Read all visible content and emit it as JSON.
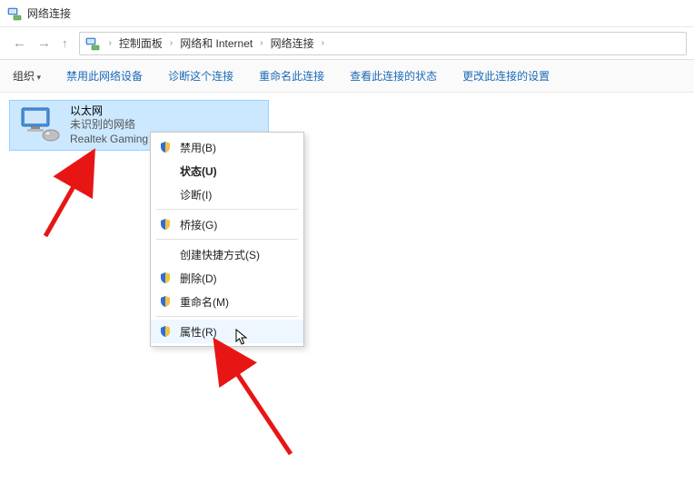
{
  "window": {
    "title": "网络连接"
  },
  "breadcrumb": {
    "items": [
      "控制面板",
      "网络和 Internet",
      "网络连接"
    ]
  },
  "toolbar": {
    "organize": "组织",
    "disable": "禁用此网络设备",
    "diagnose": "诊断这个连接",
    "rename": "重命名此连接",
    "viewstatus": "查看此连接的状态",
    "changeset": "更改此连接的设置"
  },
  "adapter": {
    "name": "以太网",
    "status": "未识别的网络",
    "device": "Realtek Gaming"
  },
  "ctx": {
    "disable": "禁用(B)",
    "status": "状态(U)",
    "diagnose": "诊断(I)",
    "bridge": "桥接(G)",
    "shortcut": "创建快捷方式(S)",
    "delete": "删除(D)",
    "rename": "重命名(M)",
    "properties": "属性(R)"
  }
}
